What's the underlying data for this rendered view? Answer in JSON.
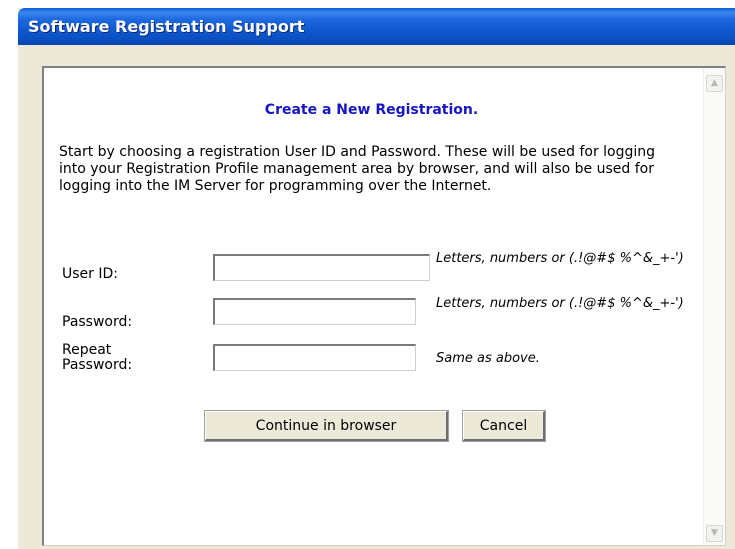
{
  "window": {
    "title": "Software Registration Support"
  },
  "form": {
    "heading": "Create a New Registration.",
    "intro": "Start by choosing a registration User ID and Password. These will be used for logging into your Registration Profile management area by browser, and will also be used for logging into the IM Server for programming over the Internet.",
    "fields": [
      {
        "label": "User ID:",
        "value": "",
        "hint": "Letters, numbers or (.!@#$ %^&_+-')"
      },
      {
        "label": "Password:",
        "value": "",
        "hint": "Letters, numbers or (.!@#$ %^&_+-')"
      },
      {
        "label": "Repeat Password:",
        "value": "",
        "hint": "Same as above."
      }
    ],
    "buttons": {
      "continue": "Continue in browser",
      "cancel": "Cancel"
    }
  },
  "icons": {
    "scroll_up": "scroll-up-arrow-icon",
    "scroll_down": "scroll-down-arrow-icon"
  },
  "colors": {
    "title_bar": "#0b58d2",
    "heading": "#1515c8",
    "window_bg": "#ece9d8"
  }
}
